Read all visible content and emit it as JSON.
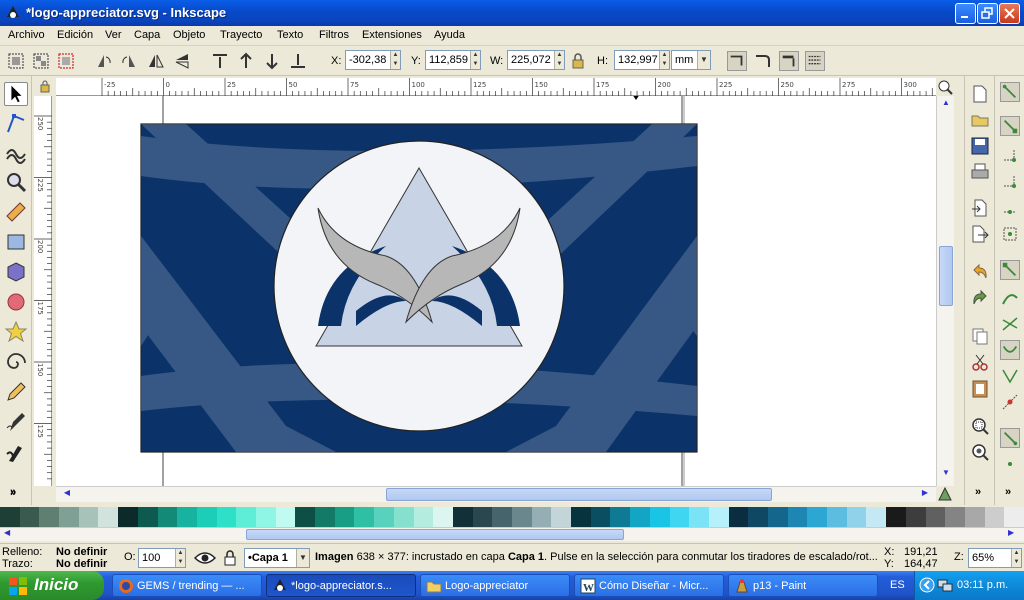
{
  "window": {
    "title": "*logo-appreciator.svg - Inkscape",
    "icon": "inkscape-icon"
  },
  "menu": [
    "Archivo",
    "Edición",
    "Ver",
    "Capa",
    "Objeto",
    "Trayecto",
    "Texto",
    "Filtros",
    "Extensiones",
    "Ayuda"
  ],
  "coords": {
    "x_label": "X:",
    "x_value": "-302,38",
    "y_label": "Y:",
    "y_value": "112,859",
    "w_label": "W:",
    "w_value": "225,072",
    "h_label": "H:",
    "h_value": "132,997",
    "unit": "mm"
  },
  "ruler": {
    "top_ticks": [
      "-25",
      "0",
      "25",
      "50",
      "75",
      "100",
      "125",
      "150",
      "175",
      "200",
      "225",
      "250",
      "275",
      "300"
    ],
    "left_ticks": [
      "250",
      "225",
      "200",
      "175",
      "150",
      "125"
    ]
  },
  "status": {
    "fill_label": "Relleno:",
    "fill_value": "No definir",
    "stroke_label": "Trazo:",
    "stroke_value": "No definir",
    "opacity_label": "O:",
    "opacity_value": "100",
    "layer": "•Capa 1",
    "message_bold": "Imagen",
    "message_1": " 638 × 377: incrustado en capa ",
    "message_layer": "Capa 1",
    "message_2": ". Pulse en la selección para conmutar los tiradores de escalado/rot...",
    "cursor_x_label": "X:",
    "cursor_x": "191,21",
    "cursor_y_label": "Y:",
    "cursor_y": "164,47",
    "zoom_label": "Z:",
    "zoom": "65%"
  },
  "palette_colors": [
    "#1e3f35",
    "#3a5a4f",
    "#5e7f72",
    "#7fa095",
    "#a7c2b8",
    "#d2e3dd",
    "#0c2a2a",
    "#0f5a50",
    "#138a78",
    "#17b3a0",
    "#1ccdb8",
    "#2fe0c8",
    "#5eeed8",
    "#8ff6e6",
    "#c0faf1",
    "#0d4f44",
    "#127a66",
    "#199e86",
    "#2fbfa5",
    "#58d2bc",
    "#86e0ce",
    "#b4ecdf",
    "#dcf6ef",
    "#123038",
    "#2a4750",
    "#46646c",
    "#6b878e",
    "#95aeb4",
    "#c3d5d9",
    "#07333f",
    "#0a4f61",
    "#0e7a93",
    "#13a5c4",
    "#19c4e4",
    "#3fd6f2",
    "#7ae4f6",
    "#b6f0fa",
    "#0a2e3f",
    "#0f4863",
    "#15668c",
    "#1d86b3",
    "#2ca6d3",
    "#5cbde0",
    "#8fd2ea",
    "#c4e8f4",
    "#1a1a1a",
    "#3d3d3d",
    "#606060",
    "#848484",
    "#a8a8a8",
    "#cdcdcd",
    "#ededed"
  ],
  "taskbar": {
    "start": "Inicio",
    "tasks": [
      {
        "label": "GEMS / trending — ...",
        "icon": "firefox-icon"
      },
      {
        "label": "*logo-appreciator.s...",
        "icon": "inkscape-icon"
      },
      {
        "label": "Logo-appreciator",
        "icon": "folder-icon"
      },
      {
        "label": "Cómo Diseñar - Micr...",
        "icon": "word-icon"
      },
      {
        "label": "p13 - Paint",
        "icon": "paint-icon"
      }
    ],
    "lang": "ES",
    "clock": "03:11 p.m."
  },
  "colors": {
    "flag_blue": "#0b336a",
    "circle": "#f2f4f8",
    "triangle": "#c9d3e6",
    "wing_grey": "#b7b7b7"
  }
}
